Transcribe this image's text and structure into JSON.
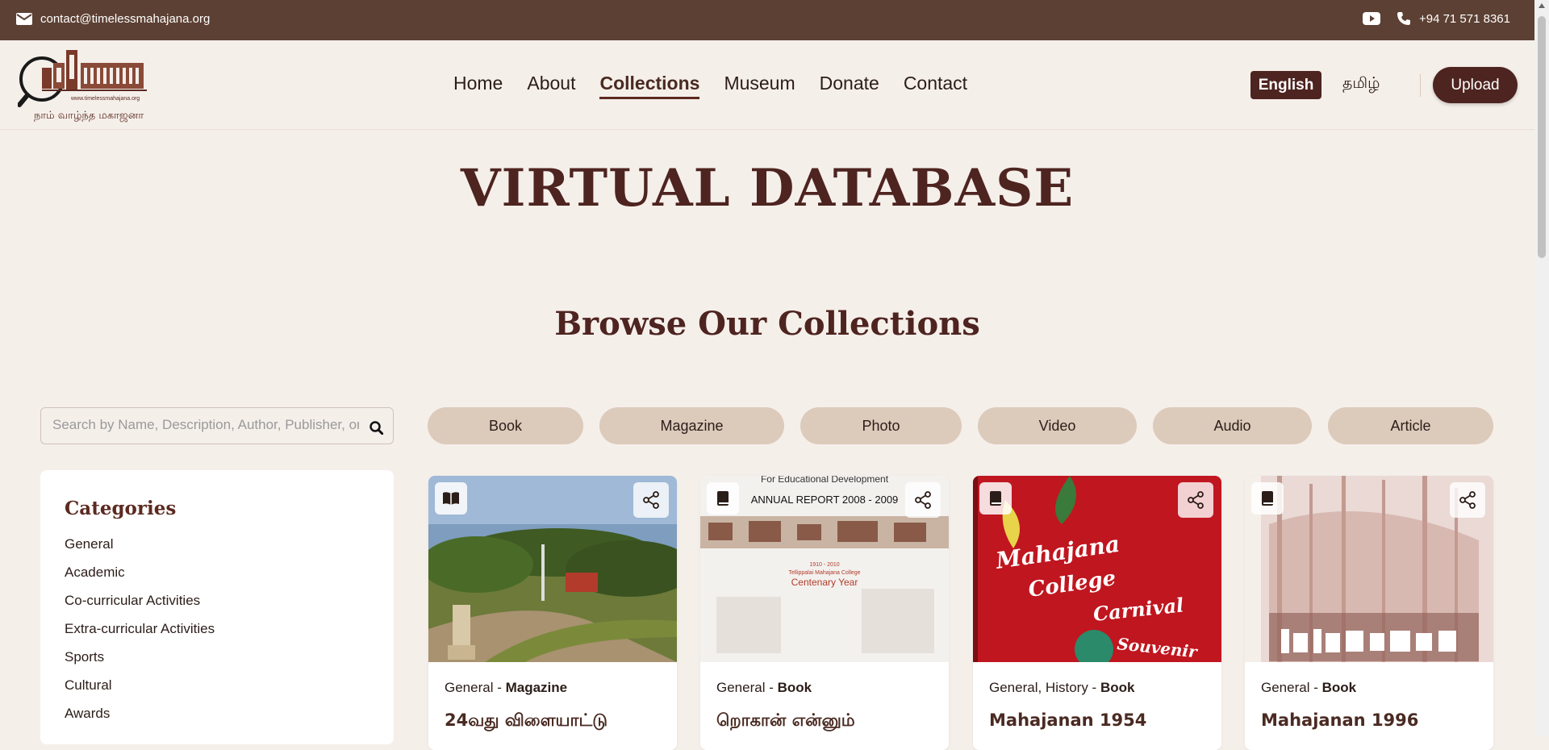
{
  "topbar": {
    "email": "contact@timelessmahajana.org",
    "phone": "+94 71 571 8361",
    "icons": [
      "envelope-icon",
      "youtube-icon",
      "phone-icon"
    ]
  },
  "logo": {
    "url_text": "www.timelessmahajana.org",
    "tagline": "நாம் வாழ்ந்த மகாஜனா"
  },
  "nav": {
    "links": [
      "Home",
      "About",
      "Collections",
      "Museum",
      "Donate",
      "Contact"
    ],
    "active": "Collections"
  },
  "lang": {
    "english": "English",
    "tamil": "தமிழ்"
  },
  "upload_label": "Upload",
  "hero": {
    "title": "VIRTUAL DATABASE"
  },
  "section": {
    "title": "Browse Our Collections"
  },
  "search": {
    "placeholder": "Search by Name, Description, Author, Publisher, or"
  },
  "types": [
    "Book",
    "Magazine",
    "Photo",
    "Video",
    "Audio",
    "Article"
  ],
  "categories": {
    "title": "Categories",
    "items": [
      "General",
      "Academic",
      "Co-curricular Activities",
      "Extra-curricular Activities",
      "Sports",
      "Cultural",
      "Awards"
    ]
  },
  "cards": [
    {
      "category": "General",
      "type": "Magazine",
      "title": "24வது விளையாட்டு",
      "icon": "open-book-icon"
    },
    {
      "category": "General",
      "type": "Book",
      "title": "றொகான் என்னும்",
      "icon": "book-icon",
      "image_text": [
        "For Educational Development",
        "ANNUAL REPORT 2008 - 2009",
        "1910 - 2010",
        "Tellippalai Mahajana College",
        "Centenary Year"
      ]
    },
    {
      "category": "General, History",
      "type": "Book",
      "title": "Mahajanan 1954",
      "icon": "book-icon",
      "image_text": [
        "Mahajana",
        "College",
        "Carnival",
        "Souvenir"
      ]
    },
    {
      "category": "General",
      "type": "Book",
      "title": "Mahajanan 1996",
      "icon": "book-icon"
    }
  ],
  "colors": {
    "brand": "#5c4033",
    "accent": "#4e2420",
    "background": "#f5efea",
    "pill": "#dccabb"
  }
}
